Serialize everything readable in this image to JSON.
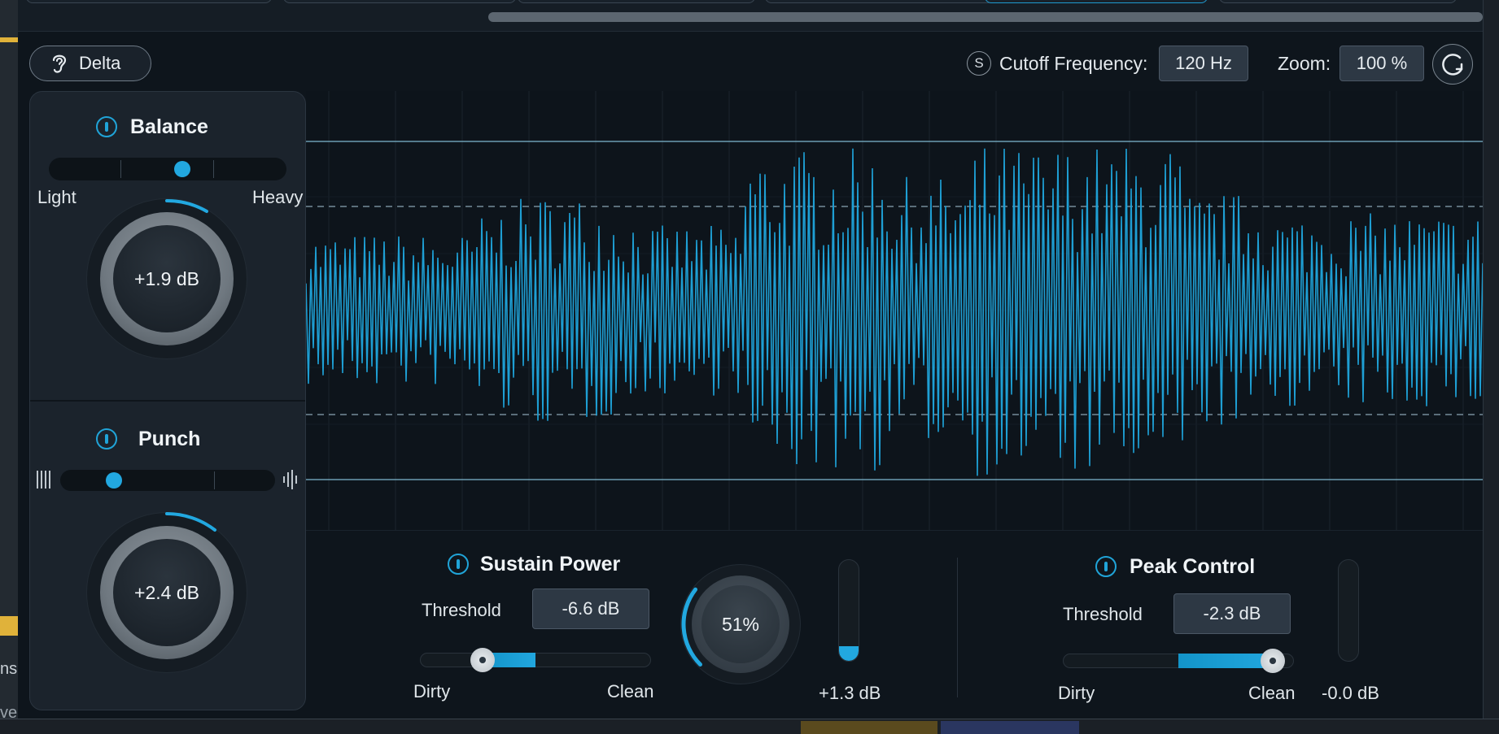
{
  "toolbar": {
    "delta_label": "Delta",
    "solo_badge": "S",
    "cutoff_label": "Cutoff Frequency:",
    "cutoff_value": "120 Hz",
    "zoom_label": "Zoom:",
    "zoom_value": "100 %"
  },
  "balance": {
    "title": "Balance",
    "left_label": "Light",
    "right_label": "Heavy",
    "slider_position": 0.56,
    "gain": "+1.9 dB"
  },
  "punch": {
    "title": "Punch",
    "slider_position": 0.25,
    "gain": "+2.4 dB"
  },
  "sustain_power": {
    "title": "Sustain Power",
    "threshold_label": "Threshold",
    "threshold_value": "-6.6 dB",
    "dirty_label": "Dirty",
    "clean_label": "Clean",
    "slider_position": 0.27,
    "mix_value": "51%",
    "mix_fraction": 0.51,
    "meter_value": "+1.3 dB",
    "meter_fraction": 0.14
  },
  "peak_control": {
    "title": "Peak Control",
    "threshold_label": "Threshold",
    "threshold_value": "-2.3 dB",
    "dirty_label": "Dirty",
    "clean_label": "Clean",
    "slider_position": 0.91,
    "meter_value": "-0.0 dB",
    "meter_fraction": 0.0
  },
  "host": {
    "left_partial_1": "ns",
    "left_partial_2": "ve"
  },
  "colors": {
    "accent": "#22a8e0",
    "waveform": "#1e9fd4",
    "background": "#0d141b"
  }
}
